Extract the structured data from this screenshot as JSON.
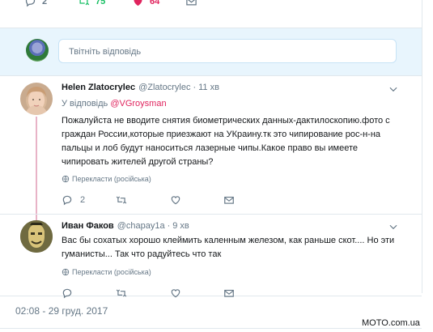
{
  "top_actions": {
    "reply_count": "2",
    "retweet_count": "75",
    "like_count": "64",
    "retweet_color": "#17bf63",
    "like_color": "#e0245e"
  },
  "reply_box": {
    "placeholder": "Твітніть відповідь"
  },
  "tweets": [
    {
      "name": "Helen Zlatocrylec",
      "handle": "@Zlatocrylec",
      "time": "11 хв",
      "reply_prefix": "У відповідь",
      "reply_to": "@VGroysman",
      "text": "Пожалуйста не вводите снятия биометрических данных-дактилоскопию.фото с  граждан России,которые приезжают на УКраину.тк это чипирование рос-н-на  пальцы и лоб будут наноситься лазерные чипы.Какое право вы имеете чипировать жителей другой страны?",
      "translate": "Перекласти (російська)",
      "reply_count": "2"
    },
    {
      "name": "Иван Факов",
      "handle": "@chapay1a",
      "time": "9 хв",
      "text": "Вас бы сохатых хорошо клеймить каленным железом, как раньше скот.... Но эти гуманисты... Так что радуйтесь что так",
      "translate": "Перекласти (російська)"
    }
  ],
  "timestamp": "02:08 - 29 груд. 2017",
  "watermark": "MOTO.com.ua",
  "colors": {
    "link_pink": "#e0245e",
    "muted": "#657786",
    "reply_bar_bg": "#e8f5fd",
    "thread_line": "#e8b3c7"
  }
}
